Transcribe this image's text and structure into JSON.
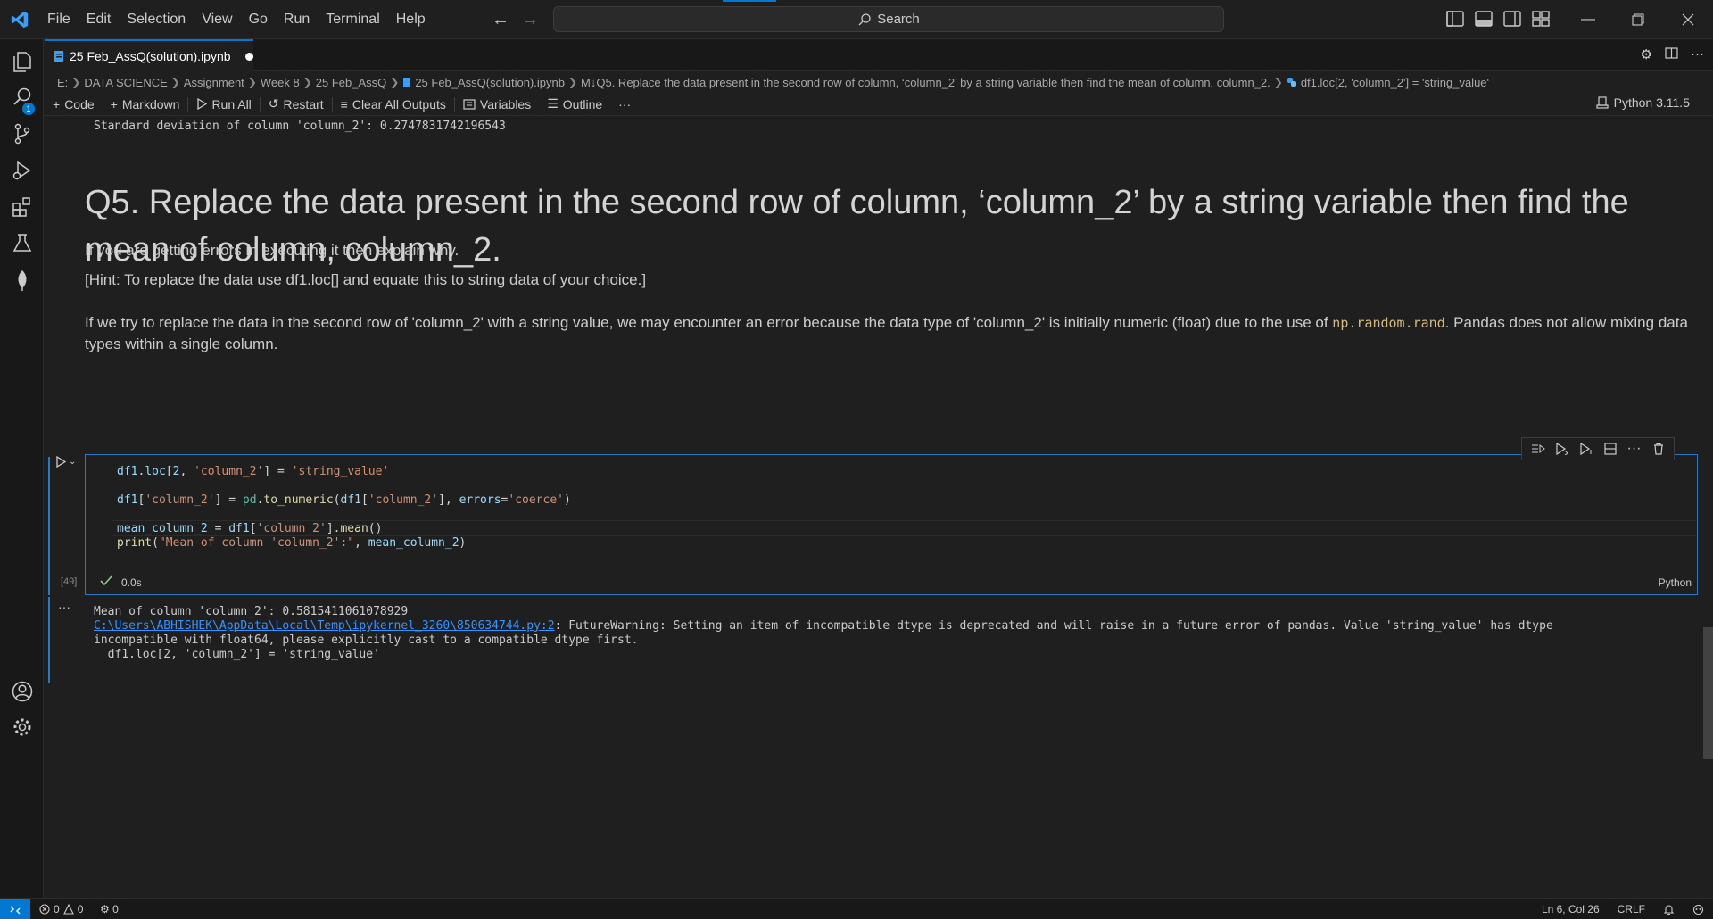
{
  "menu": [
    "File",
    "Edit",
    "Selection",
    "View",
    "Go",
    "Run",
    "Terminal",
    "Help"
  ],
  "search": {
    "label": "Search"
  },
  "tab": {
    "title": "25 Feb_AssQ(solution).ipynb"
  },
  "breadcrumb": [
    "E:",
    "DATA SCIENCE",
    "Assignment",
    "Week 8",
    "25 Feb_AssQ",
    "25 Feb_AssQ(solution).ipynb",
    "M↓Q5. Replace the data present in the second row of column, ‘column_2’ by a string variable then find the mean of column, column_2.",
    "df1.loc[2, 'column_2'] = 'string_value'"
  ],
  "toolbar": {
    "code": "Code",
    "markdown": "Markdown",
    "run_all": "Run All",
    "restart": "Restart",
    "clear_outputs": "Clear All Outputs",
    "variables": "Variables",
    "outline": "Outline",
    "more": "···",
    "kernel": "Python 3.11.5"
  },
  "notebook": {
    "prev_output": "Standard deviation of column 'column_2': 0.2747831742196543",
    "heading": "Q5. Replace the data present in the second row of column, ‘column_2’ by a string variable then find the mean of column, column_2.",
    "para1": "If you are getting errors in executing it then explain why.",
    "para2": "[Hint: To replace the data use df1.loc[] and equate this to string data of your choice.]",
    "para3_before": "If we try to replace the data in the second row of 'column_2' with a string value, we may encounter an error because the data type of 'column_2' is initially numeric (float) due to the use of ",
    "para3_code": "np.random.rand",
    "para3_after": ". Pandas does not allow mixing data types within a single column.",
    "cell": {
      "exec_count": "[49]",
      "exec_time": "0.0s",
      "language": "Python",
      "lines": [
        "df1.loc[2, 'column_2'] = 'string_value'",
        "",
        "df1['column_2'] = pd.to_numeric(df1['column_2'], errors='coerce')",
        "",
        "mean_column_2 = df1['column_2'].mean()",
        "print(\"Mean of column 'column_2':\", mean_column_2)"
      ]
    },
    "output": {
      "line1": "Mean of column 'column_2': 0.5815411061078929",
      "link": "C:\\Users\\ABHISHEK\\AppData\\Local\\Temp\\ipykernel_3260\\850634744.py:2",
      "line2_rest": ": FutureWarning: Setting an item of incompatible dtype is deprecated and will raise in a future error of pandas. Value 'string_value' has dtype",
      "line3": "incompatible with float64, please explicitly cast to a compatible dtype first.",
      "line4": "  df1.loc[2, 'column_2'] = 'string_value'"
    }
  },
  "statusbar": {
    "errors": "0",
    "warnings": "0",
    "ports": "0",
    "position": "Ln 6, Col 26",
    "eol": "CRLF"
  },
  "colors": {
    "accent": "#0078d4",
    "background": "#1f1f1f",
    "cell_border": "#2b79c2"
  }
}
